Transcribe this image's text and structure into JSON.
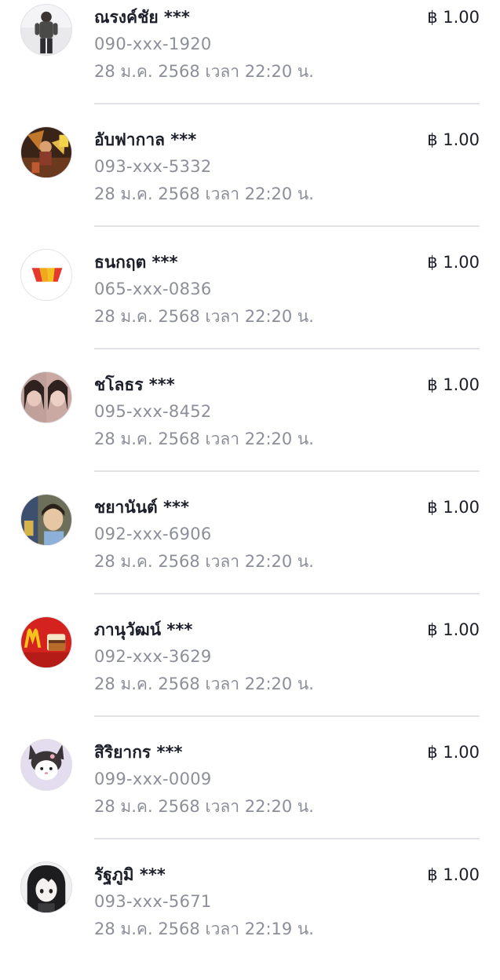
{
  "transactions": [
    {
      "name": "ณรงค์ชัย ***",
      "phone": "090-xxx-1920",
      "time": "28 ม.ค. 2568 เวลา 22:20 น.",
      "amount": "฿ 1.00",
      "avatar": "person-standing-photo"
    },
    {
      "name": "อับฟากาล ***",
      "phone": "093-xxx-5332",
      "time": "28 ม.ค. 2568 เวลา 22:20 น.",
      "amount": "฿ 1.00",
      "avatar": "game-character-photo"
    },
    {
      "name": "ธนกฤต ***",
      "phone": "065-xxx-0836",
      "time": "28 ม.ค. 2568 เวลา 22:20 น.",
      "amount": "฿ 1.00",
      "avatar": "red-yellow-logo"
    },
    {
      "name": "ชโลธร ***",
      "phone": "095-xxx-8452",
      "time": "28 ม.ค. 2568 เวลา 22:20 น.",
      "amount": "฿ 1.00",
      "avatar": "two-faces-photo"
    },
    {
      "name": "ชยานันต์ ***",
      "phone": "092-xxx-6906",
      "time": "28 ม.ค. 2568 เวลา 22:20 น.",
      "amount": "฿ 1.00",
      "avatar": "child-photo"
    },
    {
      "name": "ภานุวัฒน์ ***",
      "phone": "092-xxx-3629",
      "time": "28 ม.ค. 2568 เวลา 22:20 น.",
      "amount": "฿ 1.00",
      "avatar": "fast-food-logo"
    },
    {
      "name": "สิริยากร ***",
      "phone": "099-xxx-0009",
      "time": "28 ม.ค. 2568 เวลา 22:20 น.",
      "amount": "฿ 1.00",
      "avatar": "cartoon-character"
    },
    {
      "name": "รัฐภูมิ ***",
      "phone": "093-xxx-5671",
      "time": "28 ม.ค. 2568 เวลา 22:19 น.",
      "amount": "฿ 1.00",
      "avatar": "anime-character"
    }
  ],
  "colors": {
    "name_text": "#1c1e2a",
    "secondary_text": "#8c8f99",
    "divider": "#e3e3e7"
  }
}
